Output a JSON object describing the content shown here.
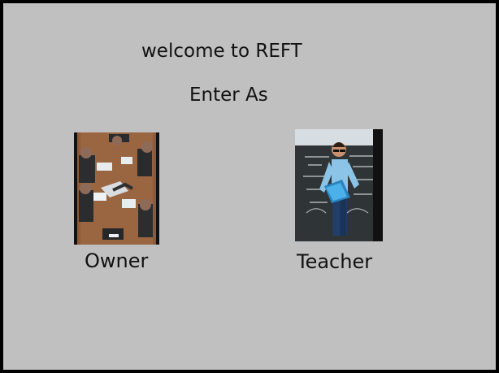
{
  "screen": {
    "welcome_text": "welcome to REFT",
    "prompt_text": "Enter As"
  },
  "options": [
    {
      "label": "Owner",
      "image_semantic": "business-meeting-photo"
    },
    {
      "label": "Teacher",
      "image_semantic": "teacher-photo"
    }
  ],
  "colors": {
    "background": "#c0c0c0",
    "window_border": "#000000",
    "text": "#111111"
  }
}
